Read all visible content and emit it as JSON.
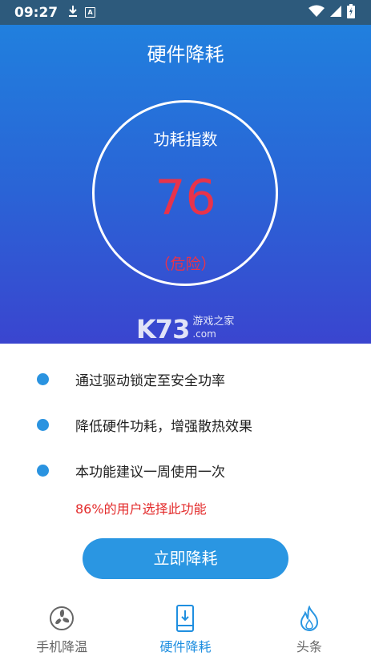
{
  "status_bar": {
    "time": "09:27",
    "icons": [
      "download-icon",
      "a-badge-icon",
      "wifi-icon",
      "signal-icon",
      "battery-charging-icon"
    ],
    "badge_letter": "A"
  },
  "header": {
    "title": "硬件降耗"
  },
  "gauge": {
    "label": "功耗指数",
    "value": "76",
    "status": "（危险）",
    "value_color": "#e8334a"
  },
  "watermark": {
    "logo": "K73",
    "name": "游戏之家",
    "domain": ".com"
  },
  "features": [
    {
      "text": "通过驱动锁定至安全功率"
    },
    {
      "text": "降低硬件功耗，增强散热效果"
    },
    {
      "text": "本功能建议一周使用一次"
    }
  ],
  "stat_note": "86%的用户选择此功能",
  "cta": {
    "label": "立即降耗"
  },
  "bottom_nav": {
    "items": [
      {
        "label": "手机降温",
        "icon": "fan-icon",
        "active": false
      },
      {
        "label": "硬件降耗",
        "icon": "phone-download-icon",
        "active": true
      },
      {
        "label": "头条",
        "icon": "flame-icon",
        "active": false
      }
    ]
  },
  "colors": {
    "accent": "#2a96e2",
    "danger": "#e8334a",
    "active_tab": "#1f8fe0",
    "inactive_tab": "#666666"
  }
}
